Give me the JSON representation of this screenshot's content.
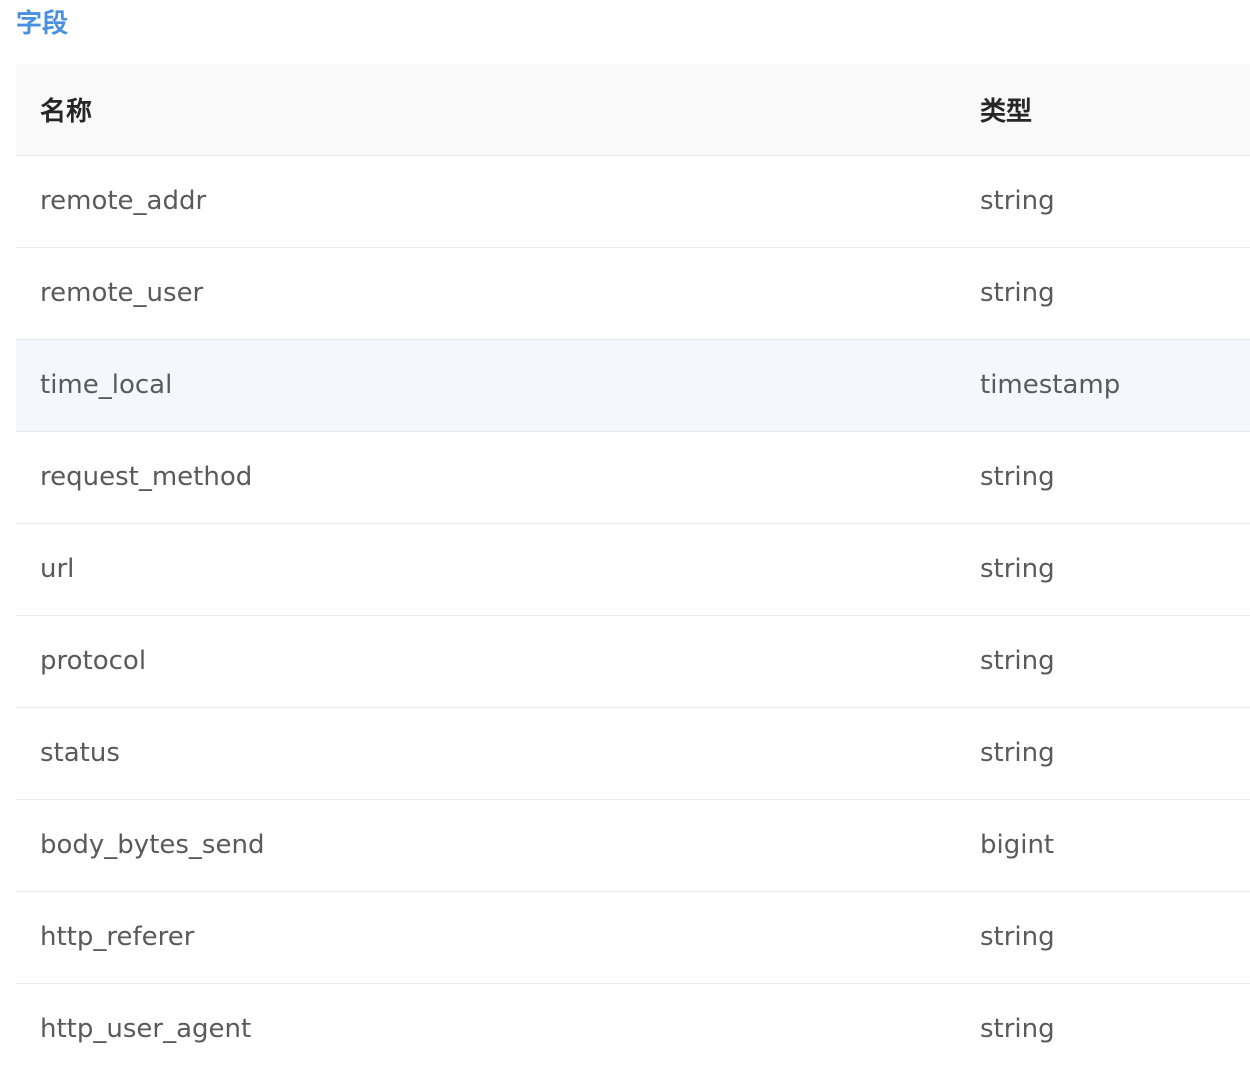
{
  "section": {
    "title": "字段"
  },
  "table": {
    "headers": {
      "name": "名称",
      "type": "类型"
    },
    "rows": [
      {
        "name": "remote_addr",
        "type": "string"
      },
      {
        "name": "remote_user",
        "type": "string"
      },
      {
        "name": "time_local",
        "type": "timestamp"
      },
      {
        "name": "request_method",
        "type": "string"
      },
      {
        "name": "url",
        "type": "string"
      },
      {
        "name": "protocol",
        "type": "string"
      },
      {
        "name": "status",
        "type": "string"
      },
      {
        "name": "body_bytes_send",
        "type": "bigint"
      },
      {
        "name": "http_referer",
        "type": "string"
      },
      {
        "name": "http_user_agent",
        "type": "string"
      }
    ],
    "highlighted_row": "time_local"
  },
  "colors": {
    "title_accent": "#4a90e2",
    "header_bg": "#f9f9f9",
    "row_highlight_bg": "#f4f8fc",
    "row_border": "#e8e8e8"
  }
}
